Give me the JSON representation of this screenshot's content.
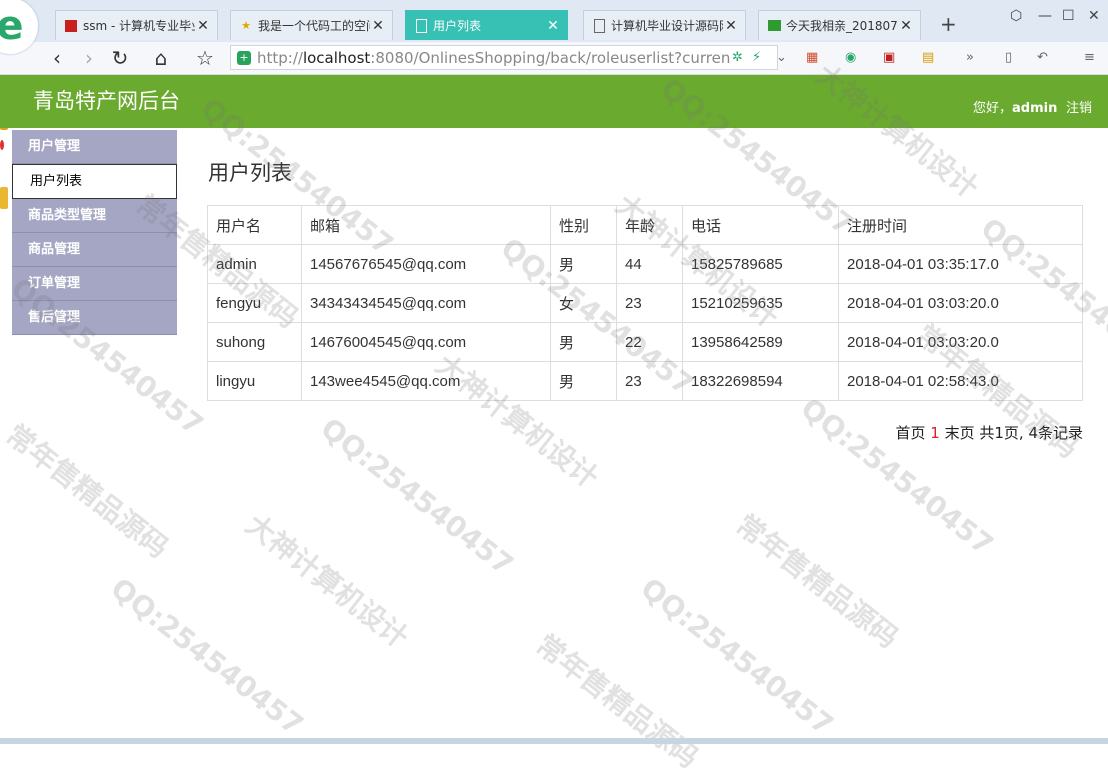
{
  "browser": {
    "tabs": [
      {
        "label": "ssm - 计算机专业毕业",
        "active": false,
        "icon": "red-square-icon"
      },
      {
        "label": "我是一个代码工的空间",
        "active": false,
        "icon": "star-icon"
      },
      {
        "label": "用户列表",
        "active": true,
        "icon": "page-icon"
      },
      {
        "label": "计算机毕业设计源码网",
        "active": false,
        "icon": "page-icon"
      },
      {
        "label": "今天我相亲_2018072",
        "active": false,
        "icon": "green-square-icon"
      }
    ],
    "url_host": "localhost",
    "url_rest": ":8080/OnlinesShopping/back/roleuserlist?curren",
    "url_prefix": "http://"
  },
  "header": {
    "title": "青岛特产网后台",
    "greeting": "您好，",
    "username": "admin",
    "logout": "注销",
    "color": "#6aaa2e"
  },
  "sidebar": {
    "items": [
      {
        "label": "用户管理",
        "type": "group"
      },
      {
        "label": "用户列表",
        "type": "item"
      },
      {
        "label": "商品类型管理",
        "type": "group"
      },
      {
        "label": "商品管理",
        "type": "group"
      },
      {
        "label": "订单管理",
        "type": "group"
      },
      {
        "label": "售后管理",
        "type": "group"
      }
    ]
  },
  "main": {
    "title": "用户列表",
    "columns": [
      "用户名",
      "邮箱",
      "性别",
      "年龄",
      "电话",
      "注册时间"
    ],
    "rows": [
      [
        "admin",
        "14567676545@qq.com",
        "男",
        "44",
        "15825789685",
        "2018-04-01 03:35:17.0"
      ],
      [
        "fengyu",
        "34343434545@qq.com",
        "女",
        "23",
        "15210259635",
        "2018-04-01 03:03:20.0"
      ],
      [
        "suhong",
        "14676004545@qq.com",
        "男",
        "22",
        "13958642589",
        "2018-04-01 03:03:20.0"
      ],
      [
        "lingyu",
        "143wee4545@qq.com",
        "男",
        "23",
        "18322698594",
        "2018-04-01 02:58:43.0"
      ]
    ]
  },
  "pager": {
    "first": "首页",
    "current": "1",
    "last": "末页",
    "summary": "共1页, 4条记录"
  },
  "watermarks": [
    "QQ:254540457",
    "大神计算机设计",
    "常年售精品源码"
  ]
}
